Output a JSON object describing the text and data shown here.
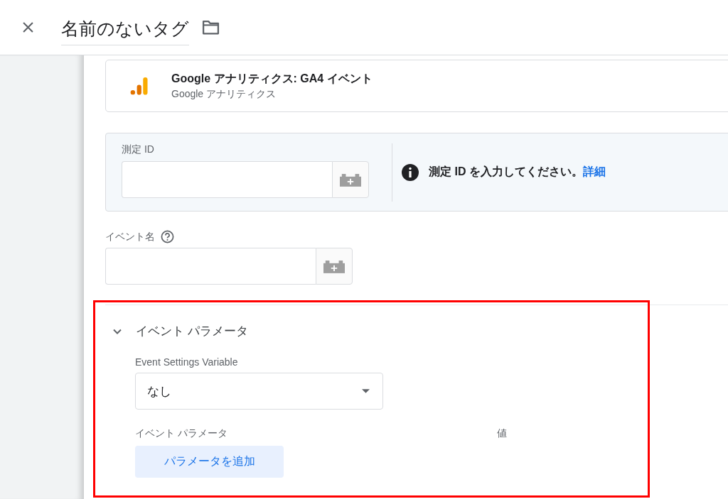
{
  "header": {
    "title": "名前のないタグ"
  },
  "tag_type": {
    "title": "Google アナリティクス: GA4 イベント",
    "subtitle": "Google アナリティクス"
  },
  "measurement_id": {
    "label": "測定 ID",
    "notice": "測定 ID を入力してください。",
    "link": "詳細"
  },
  "event_name": {
    "label": "イベント名"
  },
  "event_parameters": {
    "title": "イベント パラメータ",
    "expanded": true,
    "settings_label": "Event Settings Variable",
    "settings_value": "なし",
    "columns": [
      "イベント パラメータ",
      "値"
    ],
    "add_button": "パラメータを追加"
  }
}
